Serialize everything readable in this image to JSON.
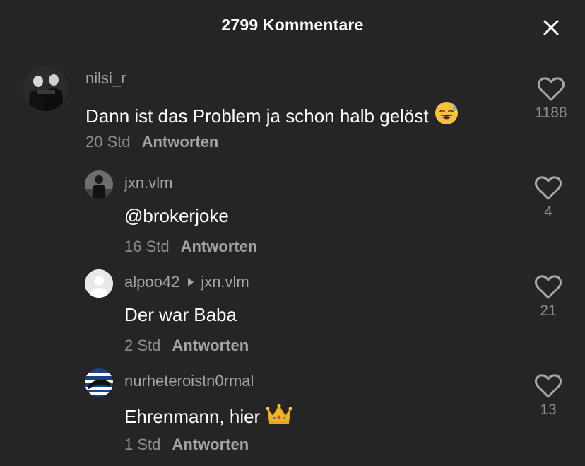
{
  "header": {
    "title": "2799 Kommentare",
    "close_icon": "close-icon"
  },
  "comments": [
    {
      "username": "nilsi_r",
      "text": "Dann ist das Problem ja schon halb gelöst",
      "emoji": "sweat-smile-emoji",
      "time": "20 Std",
      "reply_label": "Antworten",
      "likes": "1188",
      "avatar": "photo-avatar"
    },
    {
      "username": "jxn.vlm",
      "text": "@brokerjoke",
      "time": "16 Std",
      "reply_label": "Antworten",
      "likes": "4",
      "avatar": "photo-avatar"
    },
    {
      "username": "alpoo42",
      "reply_to": "jxn.vlm",
      "text": "Der war Baba",
      "time": "2 Std",
      "reply_label": "Antworten",
      "likes": "21",
      "avatar": "default-avatar"
    },
    {
      "username": "nurheteroistn0rmal",
      "text": "Ehrenmann, hier",
      "emoji": "crown-emoji",
      "time": "1 Std",
      "reply_label": "Antworten",
      "likes": "13",
      "avatar": "flag-avatar"
    }
  ],
  "colors": {
    "background": "#252525",
    "text_primary": "#ffffff",
    "text_secondary": "#a6a6a6",
    "text_meta": "#8e8e8e"
  }
}
